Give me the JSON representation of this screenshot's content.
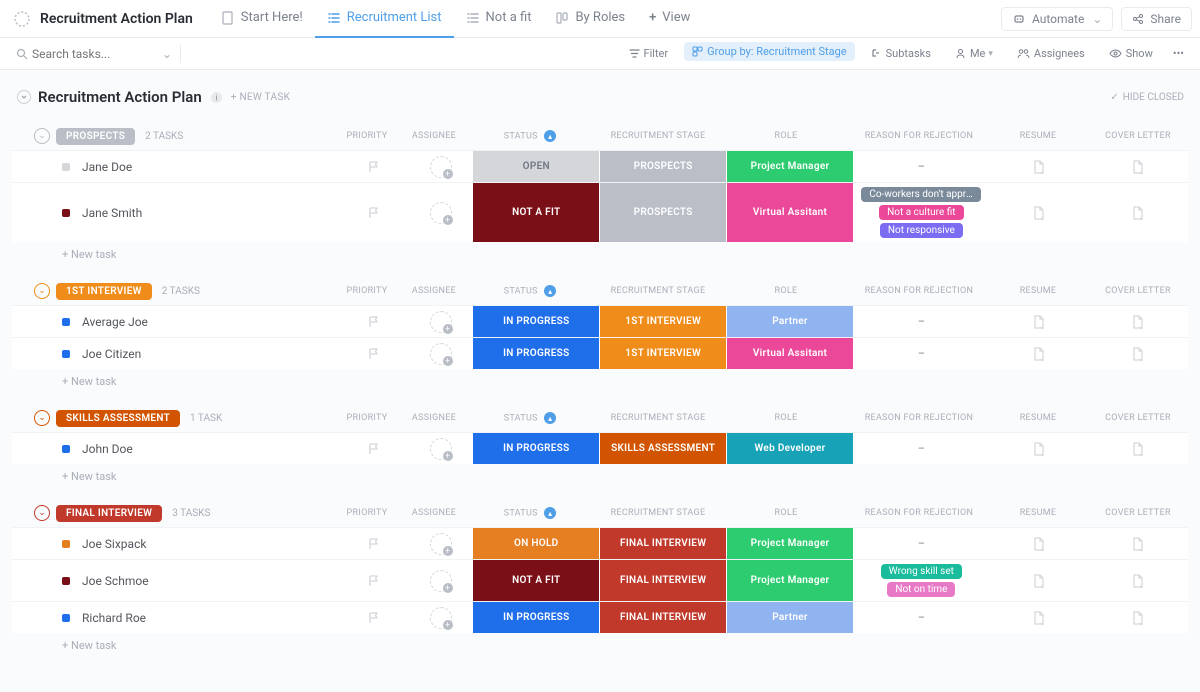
{
  "header": {
    "title": "Recruitment Action Plan",
    "tabs": [
      {
        "label": "Start Here!",
        "active": false
      },
      {
        "label": "Recruitment List",
        "active": true
      },
      {
        "label": "Not a fit",
        "active": false
      },
      {
        "label": "By Roles",
        "active": false
      }
    ],
    "view_btn": "View",
    "automate": "Automate",
    "share": "Share"
  },
  "toolbar": {
    "search_placeholder": "Search tasks...",
    "filter": "Filter",
    "group_by": "Group by: Recruitment Stage",
    "subtasks": "Subtasks",
    "me": "Me",
    "assignees": "Assignees",
    "show": "Show"
  },
  "list": {
    "title": "Recruitment Action Plan",
    "new_task": "+ NEW TASK",
    "hide_closed": "HIDE CLOSED",
    "add_row": "+ New task"
  },
  "columns": {
    "priority": "PRIORITY",
    "assignee": "ASSIGNEE",
    "status": "STATUS",
    "stage": "RECRUITMENT STAGE",
    "role": "ROLE",
    "reason": "REASON FOR REJECTION",
    "resume": "RESUME",
    "cover": "COVER LETTER"
  },
  "groups": [
    {
      "name": "PROSPECTS",
      "count": "2 TASKS",
      "color": "#b9bec7",
      "chev_color": "#b9bec7",
      "rows": [
        {
          "name": "Jane Doe",
          "dot": "#d4d6da",
          "status": {
            "label": "OPEN",
            "bg": "#d4d6da",
            "fg": "#6f7782"
          },
          "stage": {
            "label": "PROSPECTS",
            "bg": "#b9bec7"
          },
          "role": {
            "label": "Project Manager",
            "bg": "#2ecc71"
          },
          "reason": [],
          "dash": "–"
        },
        {
          "name": "Jane Smith",
          "dot": "#7b0f17",
          "status": {
            "label": "NOT A FIT",
            "bg": "#7b0f17"
          },
          "stage": {
            "label": "PROSPECTS",
            "bg": "#b9bec7"
          },
          "role": {
            "label": "Virtual Assitant",
            "bg": "#ec4899"
          },
          "reason": [
            {
              "label": "Co-workers don't appro...",
              "bg": "#7b8a9a"
            },
            {
              "label": "Not a culture fit",
              "bg": "#ec4899"
            },
            {
              "label": "Not responsive",
              "bg": "#7c6cf2"
            }
          ]
        }
      ]
    },
    {
      "name": "1ST INTERVIEW",
      "count": "2 TASKS",
      "color": "#f08c1a",
      "chev_color": "#f08c1a",
      "rows": [
        {
          "name": "Average Joe",
          "dot": "#1f6feb",
          "status": {
            "label": "IN PROGRESS",
            "bg": "#1f6feb"
          },
          "stage": {
            "label": "1ST INTERVIEW",
            "bg": "#f08c1a"
          },
          "role": {
            "label": "Partner",
            "bg": "#8fb4f0"
          },
          "reason": [],
          "dash": "–"
        },
        {
          "name": "Joe Citizen",
          "dot": "#1f6feb",
          "status": {
            "label": "IN PROGRESS",
            "bg": "#1f6feb"
          },
          "stage": {
            "label": "1ST INTERVIEW",
            "bg": "#f08c1a"
          },
          "role": {
            "label": "Virtual Assitant",
            "bg": "#ec4899"
          },
          "reason": [],
          "dash": "–"
        }
      ]
    },
    {
      "name": "SKILLS ASSESSMENT",
      "count": "1 TASK",
      "color": "#d35400",
      "chev_color": "#d35400",
      "rows": [
        {
          "name": "John Doe",
          "dot": "#1f6feb",
          "status": {
            "label": "IN PROGRESS",
            "bg": "#1f6feb"
          },
          "stage": {
            "label": "SKILLS ASSESSMENT",
            "bg": "#d35400"
          },
          "role": {
            "label": "Web Developer",
            "bg": "#17a2b8"
          },
          "reason": [],
          "dash": "–"
        }
      ]
    },
    {
      "name": "FINAL INTERVIEW",
      "count": "3 TASKS",
      "color": "#c0392b",
      "chev_color": "#c0392b",
      "rows": [
        {
          "name": "Joe Sixpack",
          "dot": "#e67e22",
          "status": {
            "label": "ON HOLD",
            "bg": "#e67e22"
          },
          "stage": {
            "label": "FINAL INTERVIEW",
            "bg": "#c0392b"
          },
          "role": {
            "label": "Project Manager",
            "bg": "#2ecc71"
          },
          "reason": [],
          "dash": "–"
        },
        {
          "name": "Joe Schmoe",
          "dot": "#7b0f17",
          "status": {
            "label": "NOT A FIT",
            "bg": "#7b0f17"
          },
          "stage": {
            "label": "FINAL INTERVIEW",
            "bg": "#c0392b"
          },
          "role": {
            "label": "Project Manager",
            "bg": "#2ecc71"
          },
          "reason": [
            {
              "label": "Wrong skill set",
              "bg": "#1abc9c"
            },
            {
              "label": "Not on time",
              "bg": "#e879c7"
            }
          ]
        },
        {
          "name": "Richard Roe",
          "dot": "#1f6feb",
          "status": {
            "label": "IN PROGRESS",
            "bg": "#1f6feb"
          },
          "stage": {
            "label": "FINAL INTERVIEW",
            "bg": "#c0392b"
          },
          "role": {
            "label": "Partner",
            "bg": "#8fb4f0"
          },
          "reason": [],
          "dash": "–"
        }
      ]
    }
  ]
}
